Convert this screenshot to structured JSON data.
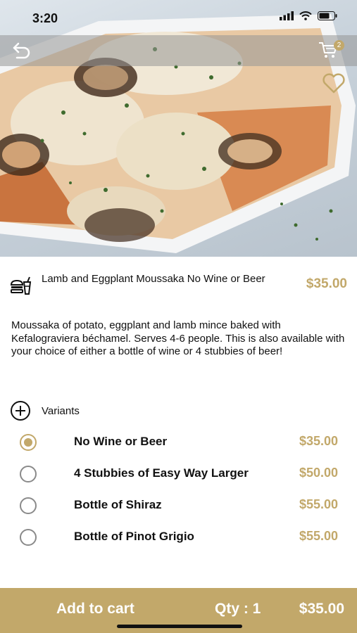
{
  "status_bar": {
    "time": "3:20"
  },
  "header": {
    "cart_count": "2"
  },
  "product": {
    "name": "Lamb and Eggplant Moussaka No Wine or Beer",
    "price": "$35.00",
    "description": "Moussaka of potato, eggplant and lamb mince baked with Kefalograviera béchamel. Serves 4-6 people. This is also available with your choice of either a bottle of wine or 4 stubbies of beer!"
  },
  "variants": {
    "label": "Variants",
    "items": [
      {
        "name": "No Wine or Beer",
        "price": "$35.00",
        "selected": true
      },
      {
        "name": "4 Stubbies of Easy Way Larger",
        "price": "$50.00",
        "selected": false
      },
      {
        "name": "Bottle of Shiraz",
        "price": "$55.00",
        "selected": false
      },
      {
        "name": "Bottle of Pinot Grigio",
        "price": "$55.00",
        "selected": false
      }
    ]
  },
  "bottom_bar": {
    "add_label": "Add to cart",
    "qty_label": "Qty : 1",
    "total": "$35.00"
  },
  "colors": {
    "accent": "#c2a86a",
    "text": "#111111"
  },
  "icons": [
    "back-arrow-icon",
    "cart-icon",
    "heart-icon",
    "food-icon",
    "plus-circle-icon"
  ]
}
